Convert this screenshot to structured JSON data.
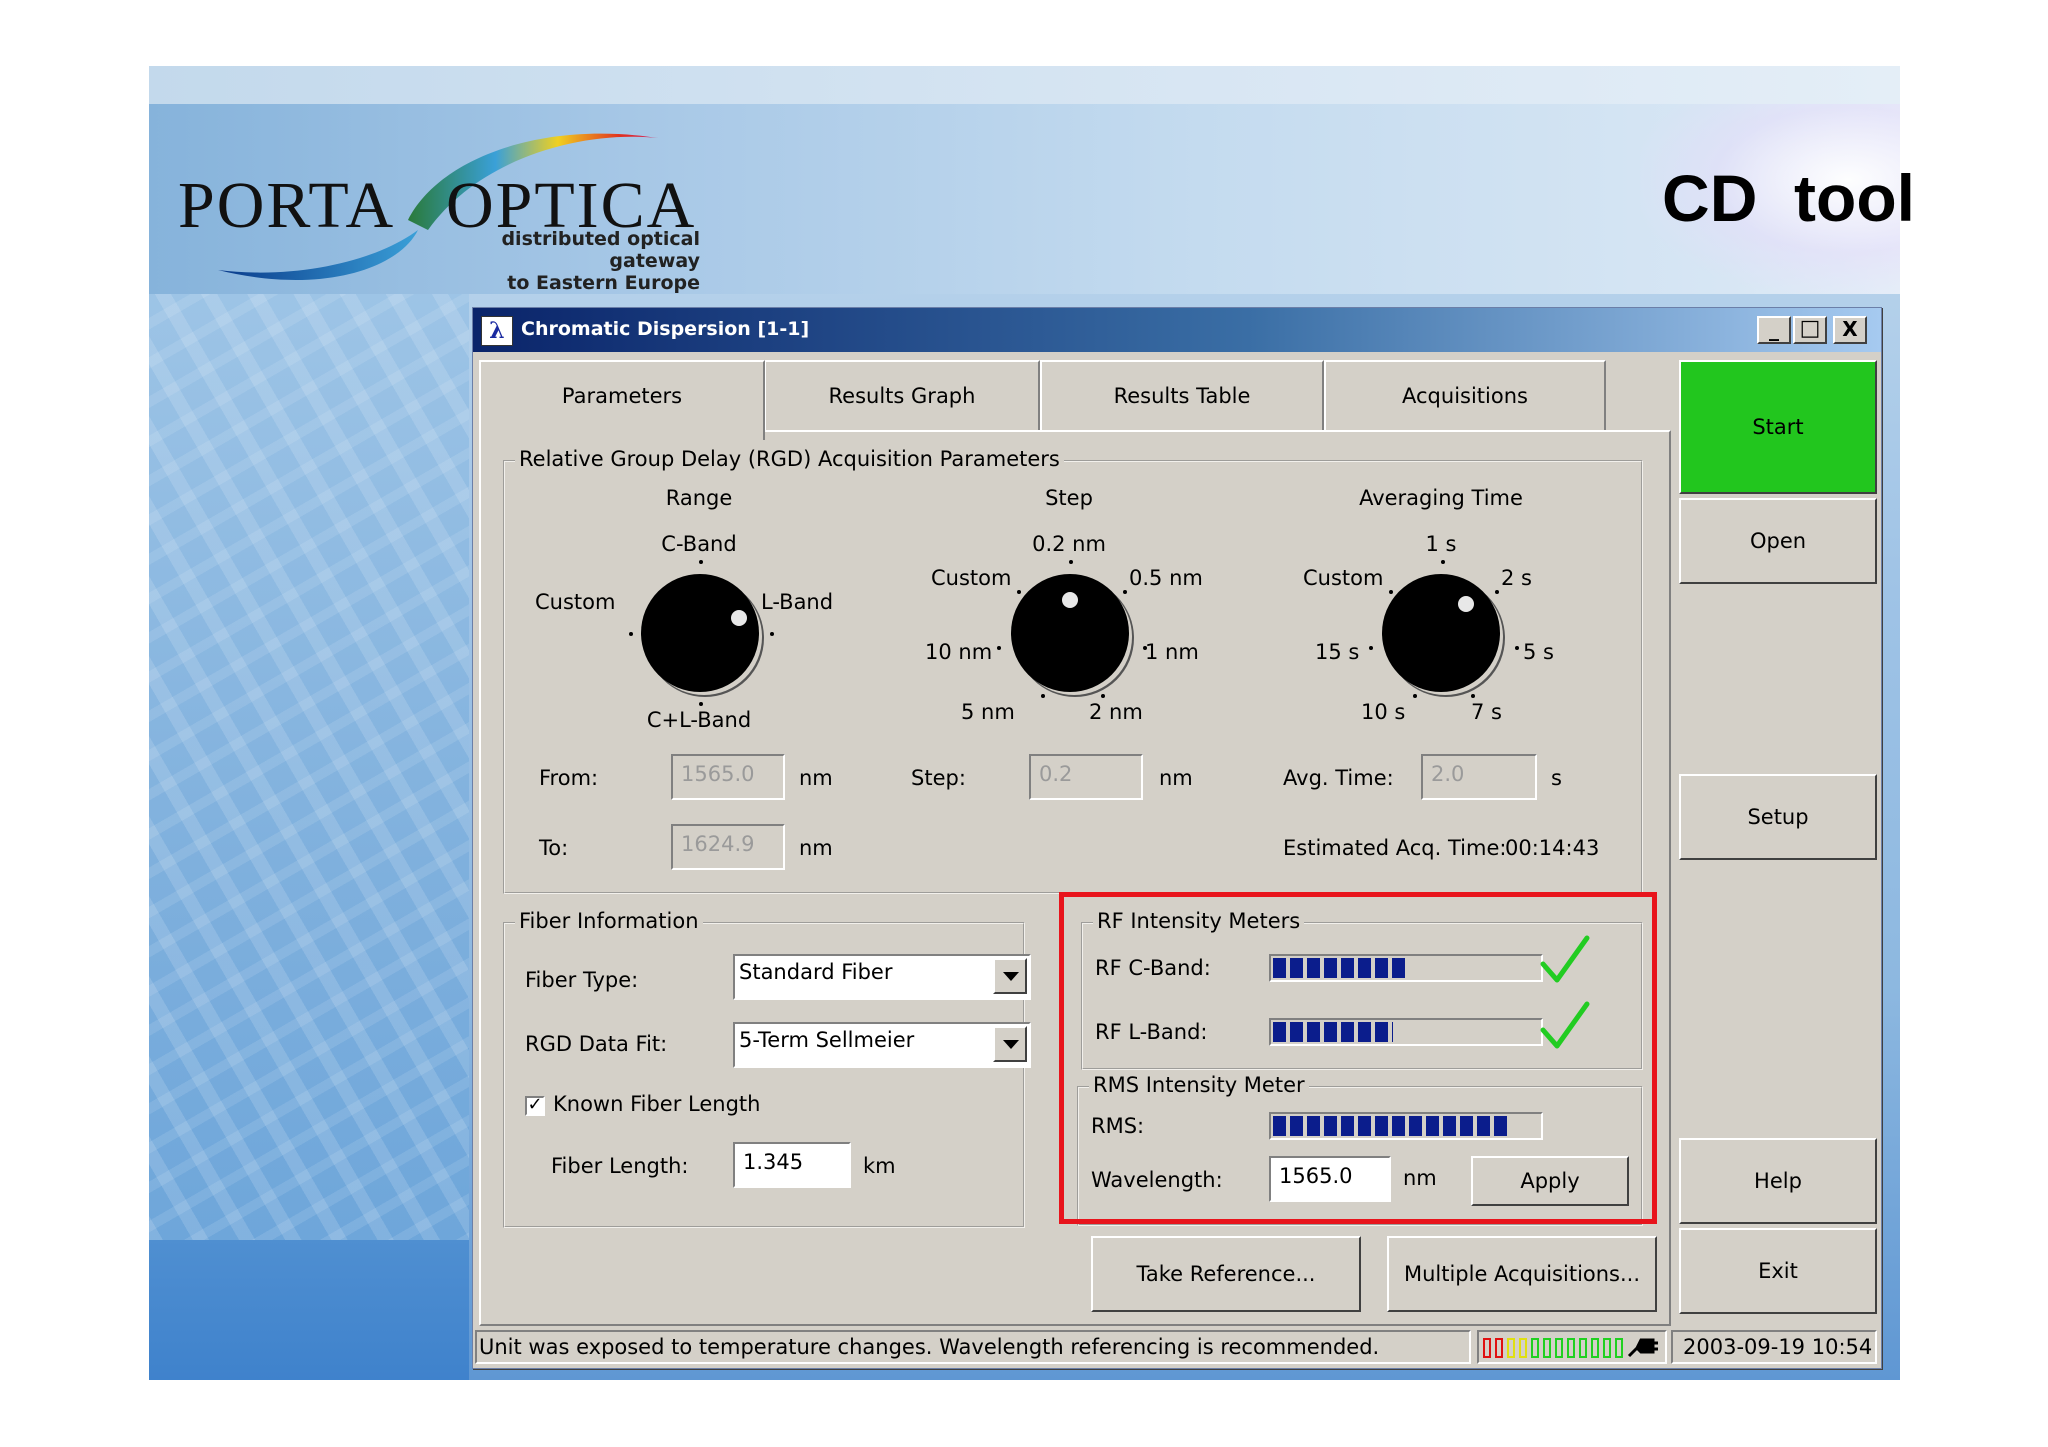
{
  "slide": {
    "logo_word_1": "PORTA",
    "logo_word_2": "OPTICA",
    "logo_tag_1": "distributed optical gateway",
    "logo_tag_2": "to Eastern Europe",
    "title": "CD  tool"
  },
  "window": {
    "title": "Chromatic Dispersion [1-1]",
    "icon_glyph": "λ",
    "minimize": "_",
    "maximize": "□",
    "close": "X"
  },
  "tabs": [
    {
      "label": "Parameters",
      "active": true
    },
    {
      "label": "Results Graph",
      "active": false
    },
    {
      "label": "Results Table",
      "active": false
    },
    {
      "label": "Acquisitions",
      "active": false
    }
  ],
  "rgd": {
    "title": "Relative Group Delay (RGD) Acquisition Parameters",
    "range": {
      "heading": "Range",
      "opt_top": "C-Band",
      "opt_left": "Custom",
      "opt_right": "L-Band",
      "opt_bottom": "C+L-Band",
      "from_label": "From:",
      "from_value": "1565.0",
      "to_label": "To:",
      "to_value": "1624.9",
      "unit": "nm"
    },
    "step": {
      "heading": "Step",
      "opt_top": "0.2 nm",
      "opt_custom": "Custom",
      "opt_05": "0.5 nm",
      "opt_10": "10 nm",
      "opt_1": "1 nm",
      "opt_5": "5 nm",
      "opt_2": "2 nm",
      "step_label": "Step:",
      "step_value": "0.2",
      "unit": "nm"
    },
    "avg": {
      "heading": "Averaging Time",
      "opt_top": "1 s",
      "opt_custom": "Custom",
      "opt_2": "2 s",
      "opt_15": "15 s",
      "opt_5": "5 s",
      "opt_10": "10 s",
      "opt_7": "7 s",
      "avg_label": "Avg. Time:",
      "avg_value": "2.0",
      "unit": "s"
    },
    "est_label": "Estimated Acq. Time:",
    "est_value": "00:14:43"
  },
  "fiber": {
    "title": "Fiber Information",
    "type_label": "Fiber Type:",
    "type_value": "Standard Fiber",
    "fit_label": "RGD Data Fit:",
    "fit_value": "5-Term Sellmeier",
    "known_length_label": "Known Fiber Length",
    "known_length_checked": "✓",
    "length_label": "Fiber Length:",
    "length_value": "1.345",
    "length_unit": "km"
  },
  "rf": {
    "title": "RF Intensity Meters",
    "c_label": "RF C-Band:",
    "c_level": 0.5,
    "l_label": "RF L-Band:",
    "l_level": 0.45,
    "check_color": "#22cc22"
  },
  "rms": {
    "title": "RMS Intensity Meter",
    "rms_label": "RMS:",
    "rms_level": 0.89,
    "wl_label": "Wavelength:",
    "wl_value": "1565.0",
    "wl_unit": "nm",
    "apply": "Apply"
  },
  "buttons": {
    "take_reference": "Take Reference...",
    "multiple": "Multiple Acquisitions...",
    "start": "Start",
    "open": "Open",
    "setup": "Setup",
    "help": "Help",
    "exit": "Exit"
  },
  "colors": {
    "start_green": "#22c61e",
    "highlight_red": "#e8141c",
    "meter_blue": "#0b1d8c"
  },
  "status": {
    "message": "Unit was exposed to temperature changes. Wavelength referencing is recommended.",
    "datetime": "2003-09-19 10:54",
    "led_colors": [
      "#e01010",
      "#e01010",
      "#e0e010",
      "#e0e010",
      "#20d020",
      "#20d020",
      "#20d020",
      "#20d020",
      "#20d020",
      "#20d020",
      "#20d020",
      "#20d020"
    ]
  }
}
